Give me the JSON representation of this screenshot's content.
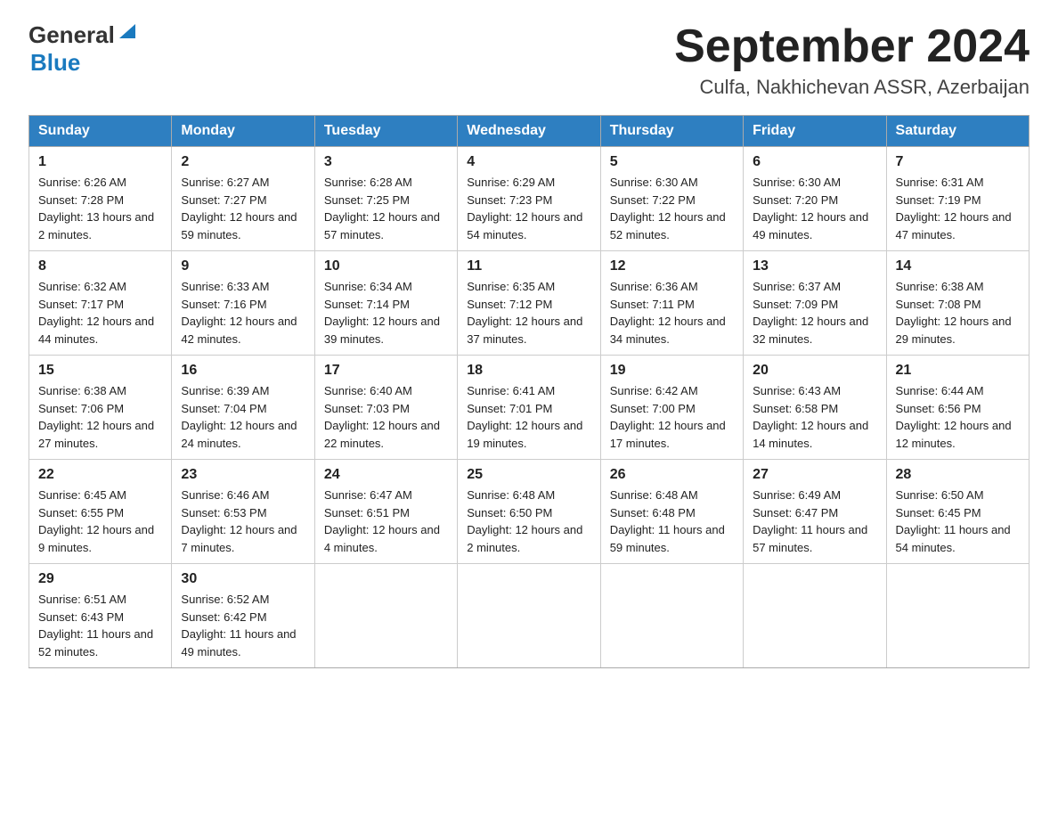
{
  "header": {
    "month_title": "September 2024",
    "location": "Culfa, Nakhichevan ASSR, Azerbaijan",
    "logo_general": "General",
    "logo_blue": "Blue"
  },
  "days_of_week": [
    "Sunday",
    "Monday",
    "Tuesday",
    "Wednesday",
    "Thursday",
    "Friday",
    "Saturday"
  ],
  "weeks": [
    [
      {
        "day": "1",
        "sunrise": "Sunrise: 6:26 AM",
        "sunset": "Sunset: 7:28 PM",
        "daylight": "Daylight: 13 hours and 2 minutes."
      },
      {
        "day": "2",
        "sunrise": "Sunrise: 6:27 AM",
        "sunset": "Sunset: 7:27 PM",
        "daylight": "Daylight: 12 hours and 59 minutes."
      },
      {
        "day": "3",
        "sunrise": "Sunrise: 6:28 AM",
        "sunset": "Sunset: 7:25 PM",
        "daylight": "Daylight: 12 hours and 57 minutes."
      },
      {
        "day": "4",
        "sunrise": "Sunrise: 6:29 AM",
        "sunset": "Sunset: 7:23 PM",
        "daylight": "Daylight: 12 hours and 54 minutes."
      },
      {
        "day": "5",
        "sunrise": "Sunrise: 6:30 AM",
        "sunset": "Sunset: 7:22 PM",
        "daylight": "Daylight: 12 hours and 52 minutes."
      },
      {
        "day": "6",
        "sunrise": "Sunrise: 6:30 AM",
        "sunset": "Sunset: 7:20 PM",
        "daylight": "Daylight: 12 hours and 49 minutes."
      },
      {
        "day": "7",
        "sunrise": "Sunrise: 6:31 AM",
        "sunset": "Sunset: 7:19 PM",
        "daylight": "Daylight: 12 hours and 47 minutes."
      }
    ],
    [
      {
        "day": "8",
        "sunrise": "Sunrise: 6:32 AM",
        "sunset": "Sunset: 7:17 PM",
        "daylight": "Daylight: 12 hours and 44 minutes."
      },
      {
        "day": "9",
        "sunrise": "Sunrise: 6:33 AM",
        "sunset": "Sunset: 7:16 PM",
        "daylight": "Daylight: 12 hours and 42 minutes."
      },
      {
        "day": "10",
        "sunrise": "Sunrise: 6:34 AM",
        "sunset": "Sunset: 7:14 PM",
        "daylight": "Daylight: 12 hours and 39 minutes."
      },
      {
        "day": "11",
        "sunrise": "Sunrise: 6:35 AM",
        "sunset": "Sunset: 7:12 PM",
        "daylight": "Daylight: 12 hours and 37 minutes."
      },
      {
        "day": "12",
        "sunrise": "Sunrise: 6:36 AM",
        "sunset": "Sunset: 7:11 PM",
        "daylight": "Daylight: 12 hours and 34 minutes."
      },
      {
        "day": "13",
        "sunrise": "Sunrise: 6:37 AM",
        "sunset": "Sunset: 7:09 PM",
        "daylight": "Daylight: 12 hours and 32 minutes."
      },
      {
        "day": "14",
        "sunrise": "Sunrise: 6:38 AM",
        "sunset": "Sunset: 7:08 PM",
        "daylight": "Daylight: 12 hours and 29 minutes."
      }
    ],
    [
      {
        "day": "15",
        "sunrise": "Sunrise: 6:38 AM",
        "sunset": "Sunset: 7:06 PM",
        "daylight": "Daylight: 12 hours and 27 minutes."
      },
      {
        "day": "16",
        "sunrise": "Sunrise: 6:39 AM",
        "sunset": "Sunset: 7:04 PM",
        "daylight": "Daylight: 12 hours and 24 minutes."
      },
      {
        "day": "17",
        "sunrise": "Sunrise: 6:40 AM",
        "sunset": "Sunset: 7:03 PM",
        "daylight": "Daylight: 12 hours and 22 minutes."
      },
      {
        "day": "18",
        "sunrise": "Sunrise: 6:41 AM",
        "sunset": "Sunset: 7:01 PM",
        "daylight": "Daylight: 12 hours and 19 minutes."
      },
      {
        "day": "19",
        "sunrise": "Sunrise: 6:42 AM",
        "sunset": "Sunset: 7:00 PM",
        "daylight": "Daylight: 12 hours and 17 minutes."
      },
      {
        "day": "20",
        "sunrise": "Sunrise: 6:43 AM",
        "sunset": "Sunset: 6:58 PM",
        "daylight": "Daylight: 12 hours and 14 minutes."
      },
      {
        "day": "21",
        "sunrise": "Sunrise: 6:44 AM",
        "sunset": "Sunset: 6:56 PM",
        "daylight": "Daylight: 12 hours and 12 minutes."
      }
    ],
    [
      {
        "day": "22",
        "sunrise": "Sunrise: 6:45 AM",
        "sunset": "Sunset: 6:55 PM",
        "daylight": "Daylight: 12 hours and 9 minutes."
      },
      {
        "day": "23",
        "sunrise": "Sunrise: 6:46 AM",
        "sunset": "Sunset: 6:53 PM",
        "daylight": "Daylight: 12 hours and 7 minutes."
      },
      {
        "day": "24",
        "sunrise": "Sunrise: 6:47 AM",
        "sunset": "Sunset: 6:51 PM",
        "daylight": "Daylight: 12 hours and 4 minutes."
      },
      {
        "day": "25",
        "sunrise": "Sunrise: 6:48 AM",
        "sunset": "Sunset: 6:50 PM",
        "daylight": "Daylight: 12 hours and 2 minutes."
      },
      {
        "day": "26",
        "sunrise": "Sunrise: 6:48 AM",
        "sunset": "Sunset: 6:48 PM",
        "daylight": "Daylight: 11 hours and 59 minutes."
      },
      {
        "day": "27",
        "sunrise": "Sunrise: 6:49 AM",
        "sunset": "Sunset: 6:47 PM",
        "daylight": "Daylight: 11 hours and 57 minutes."
      },
      {
        "day": "28",
        "sunrise": "Sunrise: 6:50 AM",
        "sunset": "Sunset: 6:45 PM",
        "daylight": "Daylight: 11 hours and 54 minutes."
      }
    ],
    [
      {
        "day": "29",
        "sunrise": "Sunrise: 6:51 AM",
        "sunset": "Sunset: 6:43 PM",
        "daylight": "Daylight: 11 hours and 52 minutes."
      },
      {
        "day": "30",
        "sunrise": "Sunrise: 6:52 AM",
        "sunset": "Sunset: 6:42 PM",
        "daylight": "Daylight: 11 hours and 49 minutes."
      },
      null,
      null,
      null,
      null,
      null
    ]
  ]
}
